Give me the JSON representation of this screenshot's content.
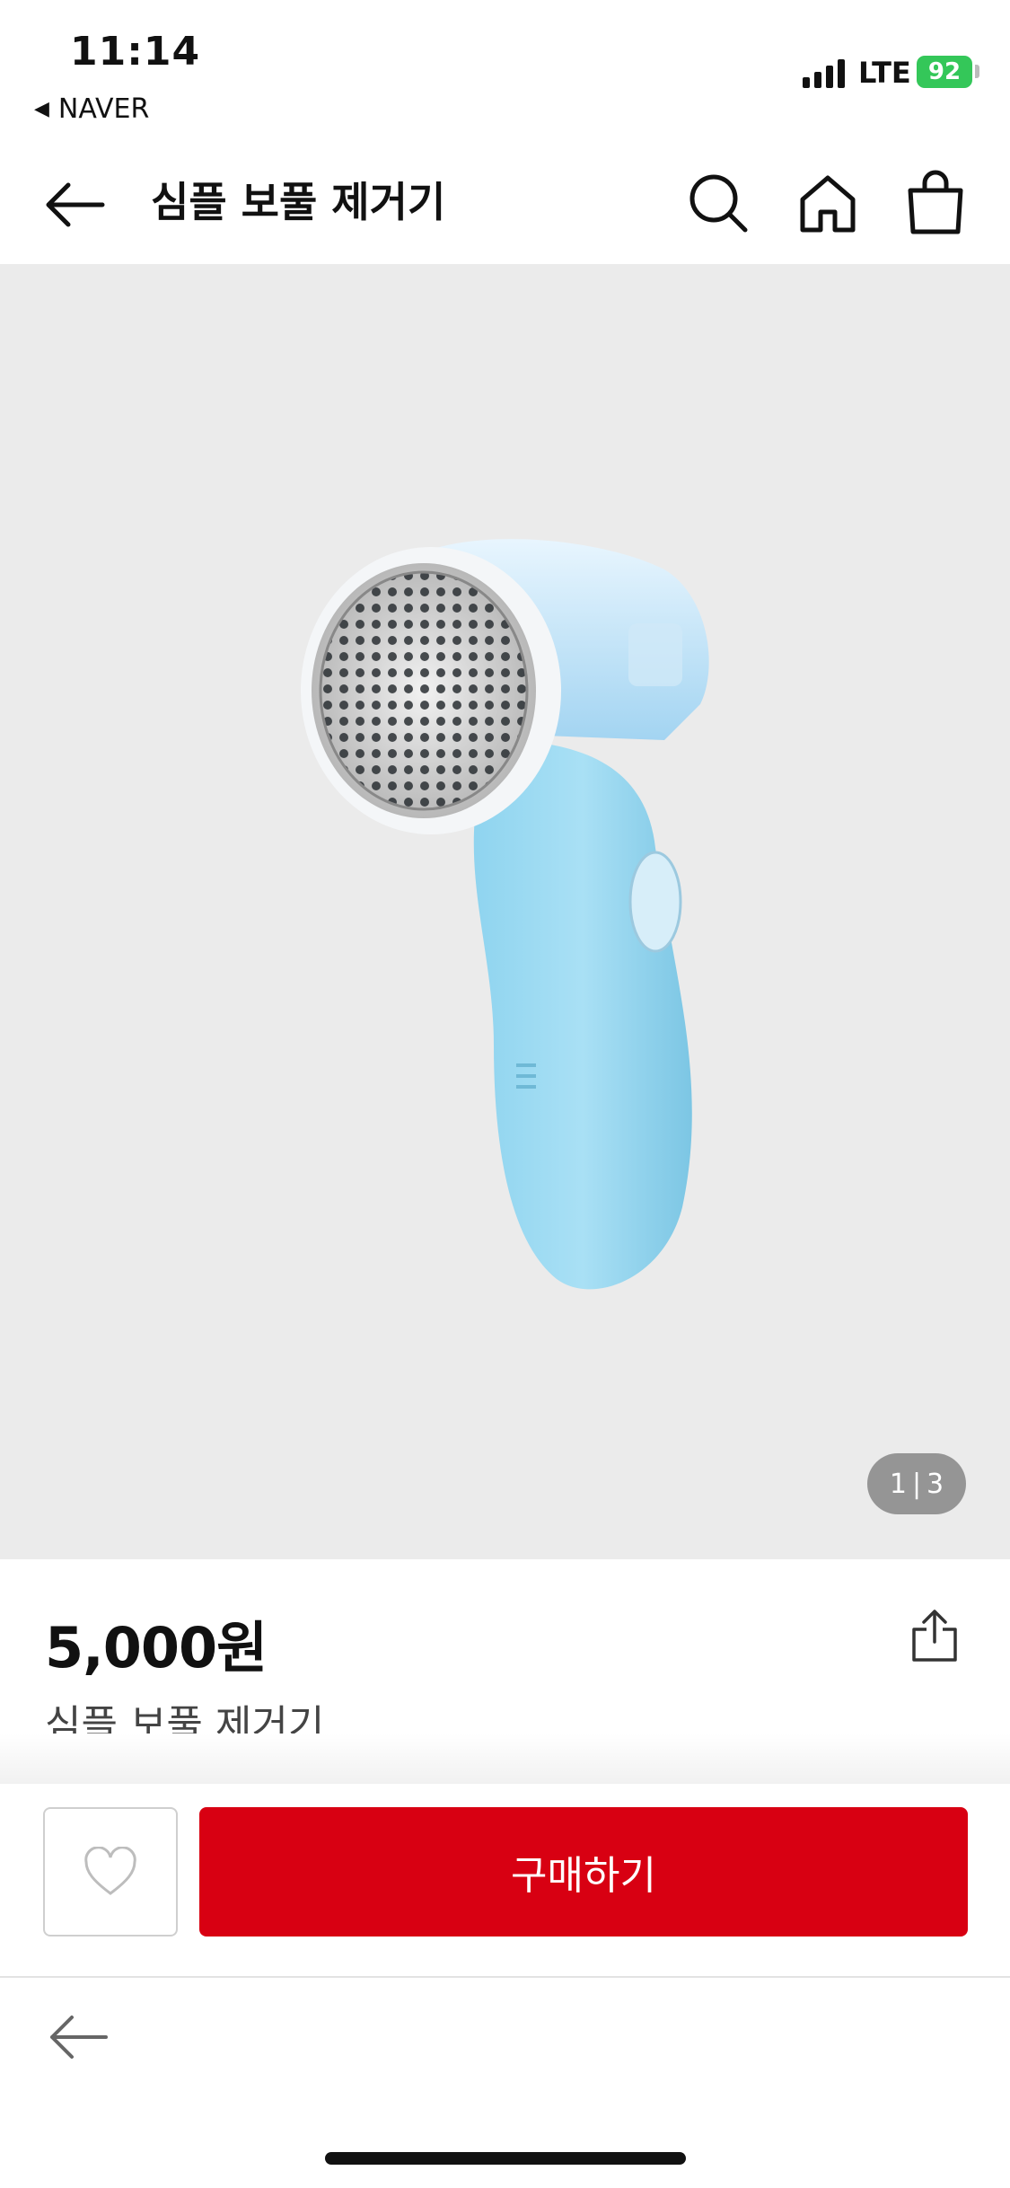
{
  "status_bar": {
    "time": "11:14",
    "back_app": "NAVER",
    "network": "LTE",
    "battery": "92"
  },
  "header": {
    "title": "심플 보풀 제거기",
    "icons": [
      "back-arrow-icon",
      "search-icon",
      "home-icon",
      "shopping-bag-icon"
    ]
  },
  "gallery": {
    "current": "1",
    "total": "3"
  },
  "product": {
    "price": "5,000원",
    "name": "심플 보풀 제거기"
  },
  "actions": {
    "buy_label": "구매하기",
    "wish_icon": "heart-icon"
  },
  "colors": {
    "buy_button": "#d80012",
    "battery": "#34c759",
    "gallery_bg": "#ebebeb"
  }
}
